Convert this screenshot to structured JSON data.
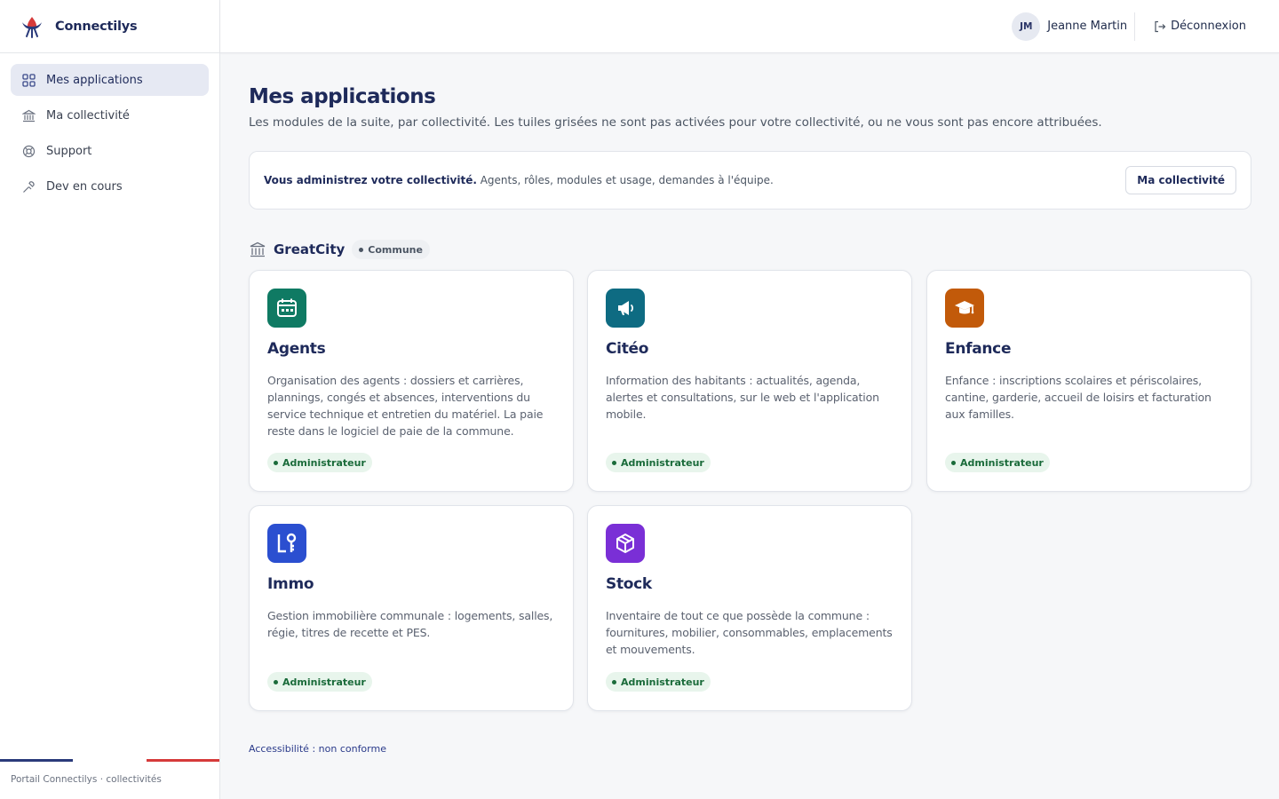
{
  "brand": {
    "name": "Connectilys",
    "logo_icon": "connectilys-logo"
  },
  "sidebar": {
    "items": [
      {
        "label": "Mes applications",
        "icon": "grid-icon",
        "active": true
      },
      {
        "label": "Ma collectivité",
        "icon": "building-icon",
        "active": false
      },
      {
        "label": "Support",
        "icon": "lifebuoy-icon",
        "active": false
      },
      {
        "label": "Dev en cours",
        "icon": "tools-icon",
        "active": false
      }
    ],
    "footer": "Portail Connectilys · collectivités",
    "tricolor": [
      "#2a3a7a",
      "#ffffff",
      "#d63a3a"
    ]
  },
  "topbar": {
    "user_initials": "JM",
    "user_name": "Jeanne Martin",
    "logout_label": "Déconnexion"
  },
  "page": {
    "title": "Mes applications",
    "subtitle": "Les modules de la suite, par collectivité. Les tuiles grisées ne sont pas activées pour votre collectivité, ou ne vous sont pas encore attribuées."
  },
  "admin_banner": {
    "strong": "Vous administrez votre collectivité.",
    "text": " Agents, rôles, modules et usage, demandes à l'équipe.",
    "button_label": "Ma collectivité"
  },
  "group": {
    "name": "GreatCity",
    "badge": "Commune"
  },
  "apps": [
    {
      "title": "Agents",
      "icon": "calendar-icon",
      "color": "#0f7a63",
      "role": "Administrateur",
      "description": "Organisation des agents : dossiers et carrières, plannings, congés et absences, interventions du service technique et entretien du matériel. La paie reste dans le logiciel de paie de la commune."
    },
    {
      "title": "Citéo",
      "icon": "megaphone-icon",
      "color": "#0e6b82",
      "role": "Administrateur",
      "description": "Information des habitants : actualités, agenda, alertes et consultations, sur le web et l'application mobile."
    },
    {
      "title": "Enfance",
      "icon": "graduation-cap-icon",
      "color": "#c25a0a",
      "role": "Administrateur",
      "description": "Enfance : inscriptions scolaires et périscolaires, cantine, garderie, accueil de loisirs et facturation aux familles."
    },
    {
      "title": "Immo",
      "icon": "key-building-icon",
      "color": "#2b4fd0",
      "role": "Administrateur",
      "description": "Gestion immobilière communale : logements, salles, régie, titres de recette et PES."
    },
    {
      "title": "Stock",
      "icon": "box-icon",
      "color": "#7a2fd6",
      "role": "Administrateur",
      "description": "Inventaire de tout ce que possède la commune : fournitures, mobilier, consommables, emplacements et mouvements."
    }
  ],
  "footer": {
    "accessibility": "Accessibilité : non conforme"
  }
}
